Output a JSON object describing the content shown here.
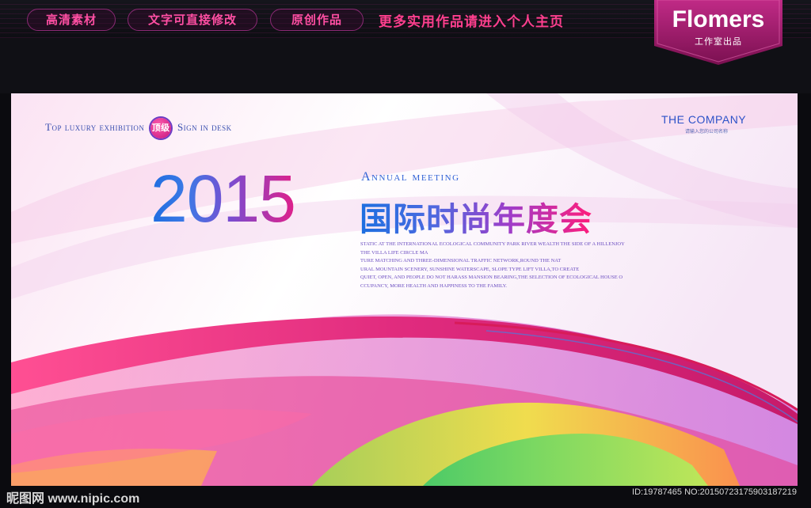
{
  "topbar": {
    "tags": [
      "高清素材",
      "文字可直接修改",
      "原创作品"
    ],
    "promo": "更多实用作品请进入个人主页",
    "brand": "Flomers",
    "brand_sub": "工作室出品"
  },
  "poster": {
    "top_left_1": "Top luxury exhibition",
    "badge": "顶级",
    "top_left_2": "Sign in desk",
    "company": "THE COMPANY",
    "company_sub": "请输入您的公司名称",
    "year": "2015",
    "annual_meeting": "Annual meeting",
    "title_cn": "国际时尚年度会",
    "body_lines": [
      "STATIC AT THE INTERNATIONAL ECOLOGICAL COMMUNITY PARK RIVER WEALTH THE SIDE OF A HILLENJOY",
      "THE VILLA LIFE CIRCLE MA",
      "TURE MATCHING AND THREE-DIMENSIONAL TRAFFIC NETWORK,ROUND THE NAT",
      "URAL MOUNTAIN SCENERY, SUNSHINE WATERSCAPE, SLOPE TYPE LIFT VILLA,TO CREATE",
      "QUIET, OPEN, AND PEOPLE DO NOT HARASS MANSION BEARING,THE SELECTION OF ECOLOGICAL HOUSE O",
      "CCUPANCY, MORE HEALTH AND HAPPINESS TO THE FAMILY."
    ]
  },
  "footer": {
    "site": "昵图网 www.nipic.com",
    "id": "ID:19787465 NO:20150723175903187219"
  },
  "colors": {
    "accent_pink": "#ff3f8e",
    "brand_badge": "#a01e6e",
    "title_blue": "#1f6de0",
    "title_pink": "#e0208a"
  }
}
